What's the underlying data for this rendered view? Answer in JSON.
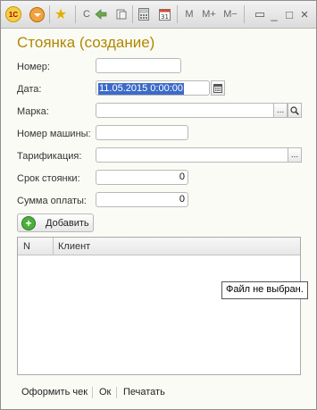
{
  "toolbar": {
    "logo_text": "1С",
    "c_label": "С",
    "m_label": "M",
    "m_plus_label": "M+",
    "m_minus_label": "M−",
    "minimize_icon": "_",
    "maximize_icon": "□",
    "close_icon": "×",
    "icons": [
      "logo-icon",
      "main-menu-icon",
      "favorites-star-icon",
      "back-forward-icon",
      "calculator-icon",
      "calendar-icon",
      "fullscreen-icon"
    ]
  },
  "form": {
    "title": "Стоянка (создание)",
    "fields": {
      "number_label": "Номер:",
      "number_value": "",
      "date_label": "Дата:",
      "date_value": "11.05.2015  0:00:00",
      "brand_label": "Марка:",
      "brand_value": "",
      "car_number_label": "Номер машины:",
      "car_number_value": "",
      "tariff_label": "Тарификация:",
      "tariff_value": "",
      "term_label": "Срок стоянки:",
      "term_value": "0",
      "sum_label": "Сумма оплаты:",
      "sum_value": "0"
    },
    "choose_btn": "...",
    "add_button": "Добавить",
    "table": {
      "columns": [
        "N",
        "Клиент"
      ],
      "rows": []
    },
    "tooltip": "Файл не выбран.",
    "footer": {
      "receipt": "Оформить чек",
      "ok": "Ок",
      "print": "Печатать"
    }
  },
  "colors": {
    "title": "#b08800",
    "selection": "#3c6bc8",
    "add_icon": "#4caf3c"
  }
}
